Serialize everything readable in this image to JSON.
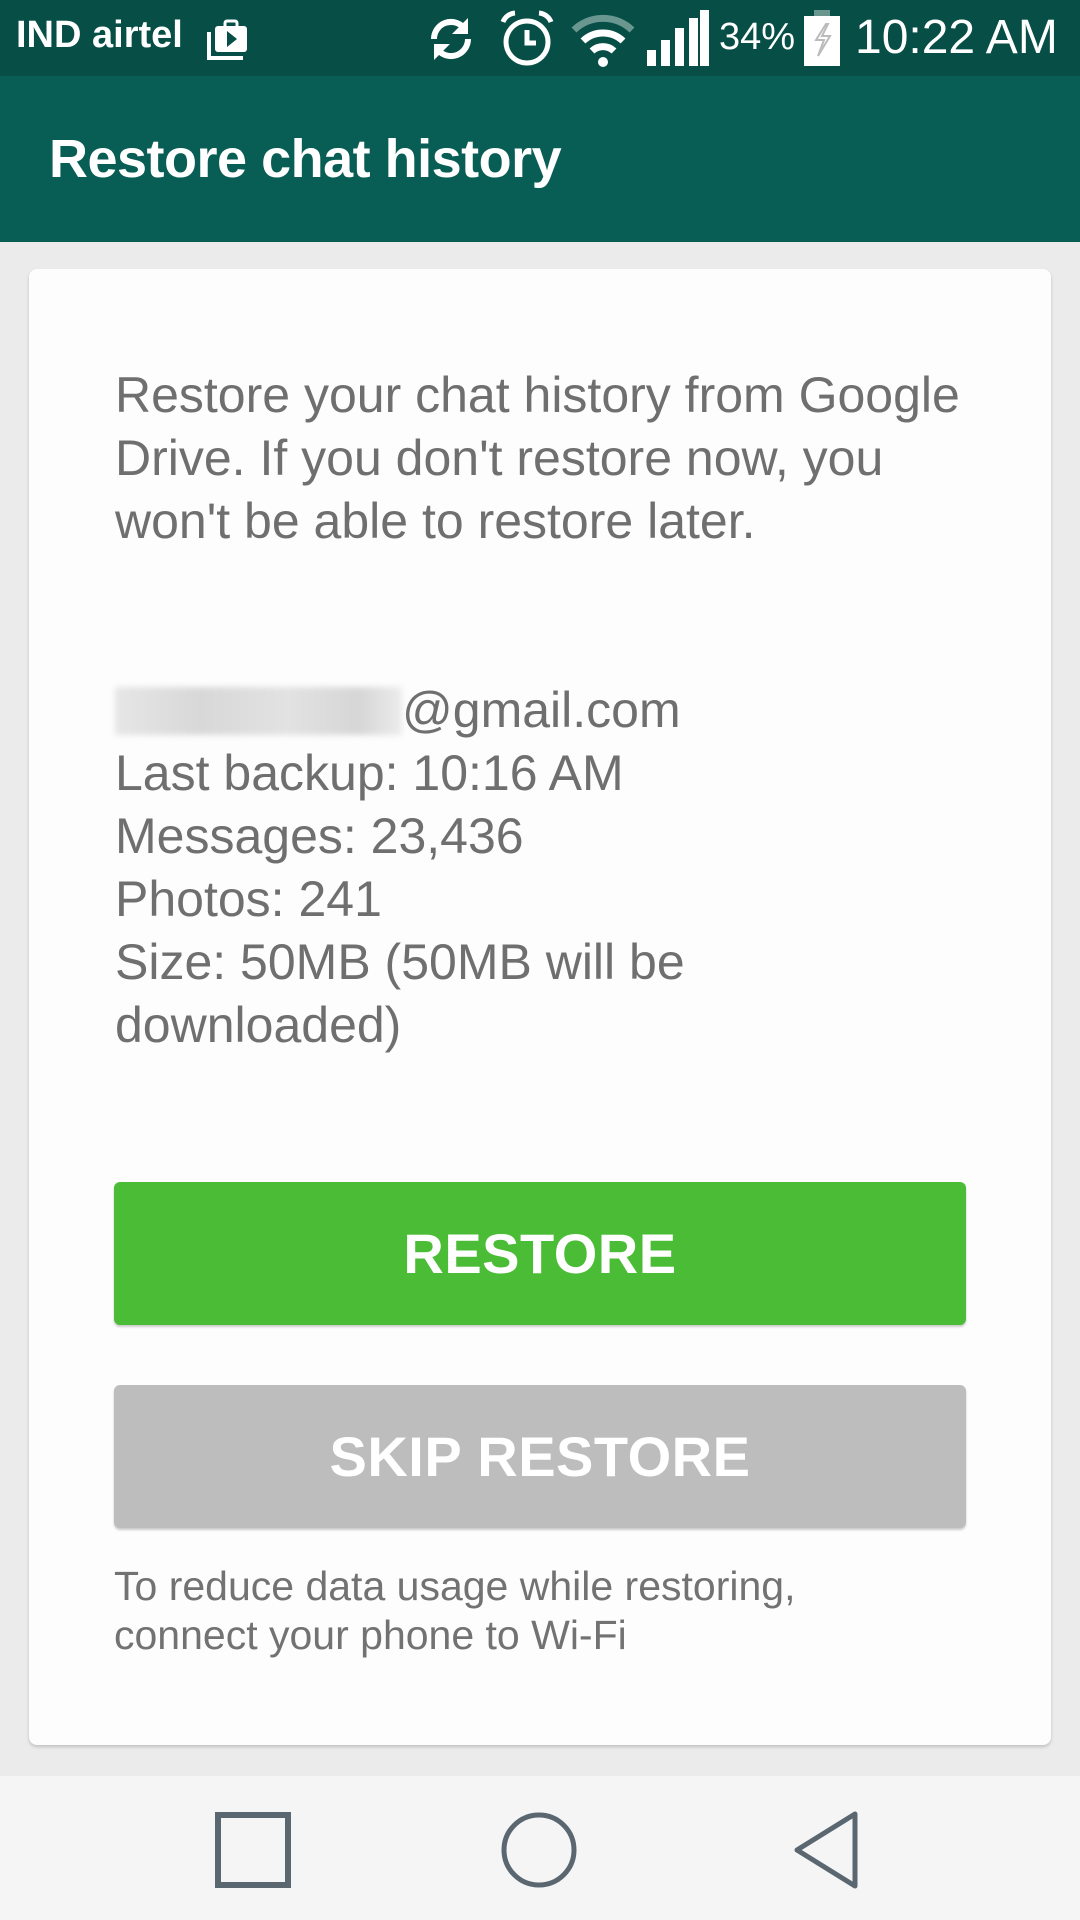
{
  "status_bar": {
    "carrier": "IND airtel",
    "icons": [
      "briefcase-play-icon",
      "sync-icon",
      "alarm-icon",
      "wifi-icon",
      "signal-icon",
      "battery-charging-icon"
    ],
    "battery_percent": "34%",
    "time": "10:22 AM"
  },
  "app_bar": {
    "title": "Restore chat history"
  },
  "card": {
    "description": "Restore your chat history from Google Drive. If you don't restore now, you won't be able to restore later.",
    "account_email_domain": "@gmail.com",
    "account_email_redacted": true,
    "last_backup": "Last backup: 10:16 AM",
    "messages": "Messages: 23,436",
    "photos": "Photos: 241",
    "size": "Size: 50MB (50MB will be downloaded)",
    "restore_button": "RESTORE",
    "skip_button": "SKIP RESTORE",
    "footer_note": "To reduce data usage while restoring, connect your phone to Wi-Fi"
  },
  "colors": {
    "status_bar": "#064e46",
    "app_bar": "#085e54",
    "restore_button": "#4bbc35",
    "skip_button": "#bdbdbd",
    "body_text": "#6f6f6f"
  },
  "nav_bar": {
    "buttons": [
      "recents-icon",
      "home-icon",
      "back-icon"
    ]
  }
}
